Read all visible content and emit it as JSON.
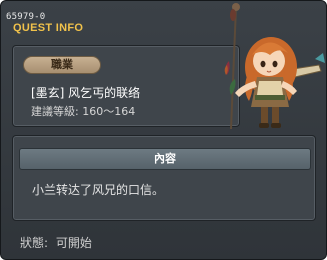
{
  "window": {
    "quest_id": "65979-0",
    "header_title": "QUEST INFO"
  },
  "info": {
    "job_label": "職業",
    "quest_name": "[墨玄] 风乞丐的联络",
    "level_requirement": "建議等級: 160～164"
  },
  "content": {
    "header_label": "內容",
    "text": "小兰转达了风兄的口信。"
  },
  "status": {
    "label": "狀態:",
    "value": "可開始"
  },
  "npc": {
    "icon": "npc-character-portrait"
  },
  "colors": {
    "header_title": "#f1c24b",
    "window_bg": "#353a3f",
    "panel_bg": "#3f454b",
    "badge_bg": "#b9a283"
  }
}
